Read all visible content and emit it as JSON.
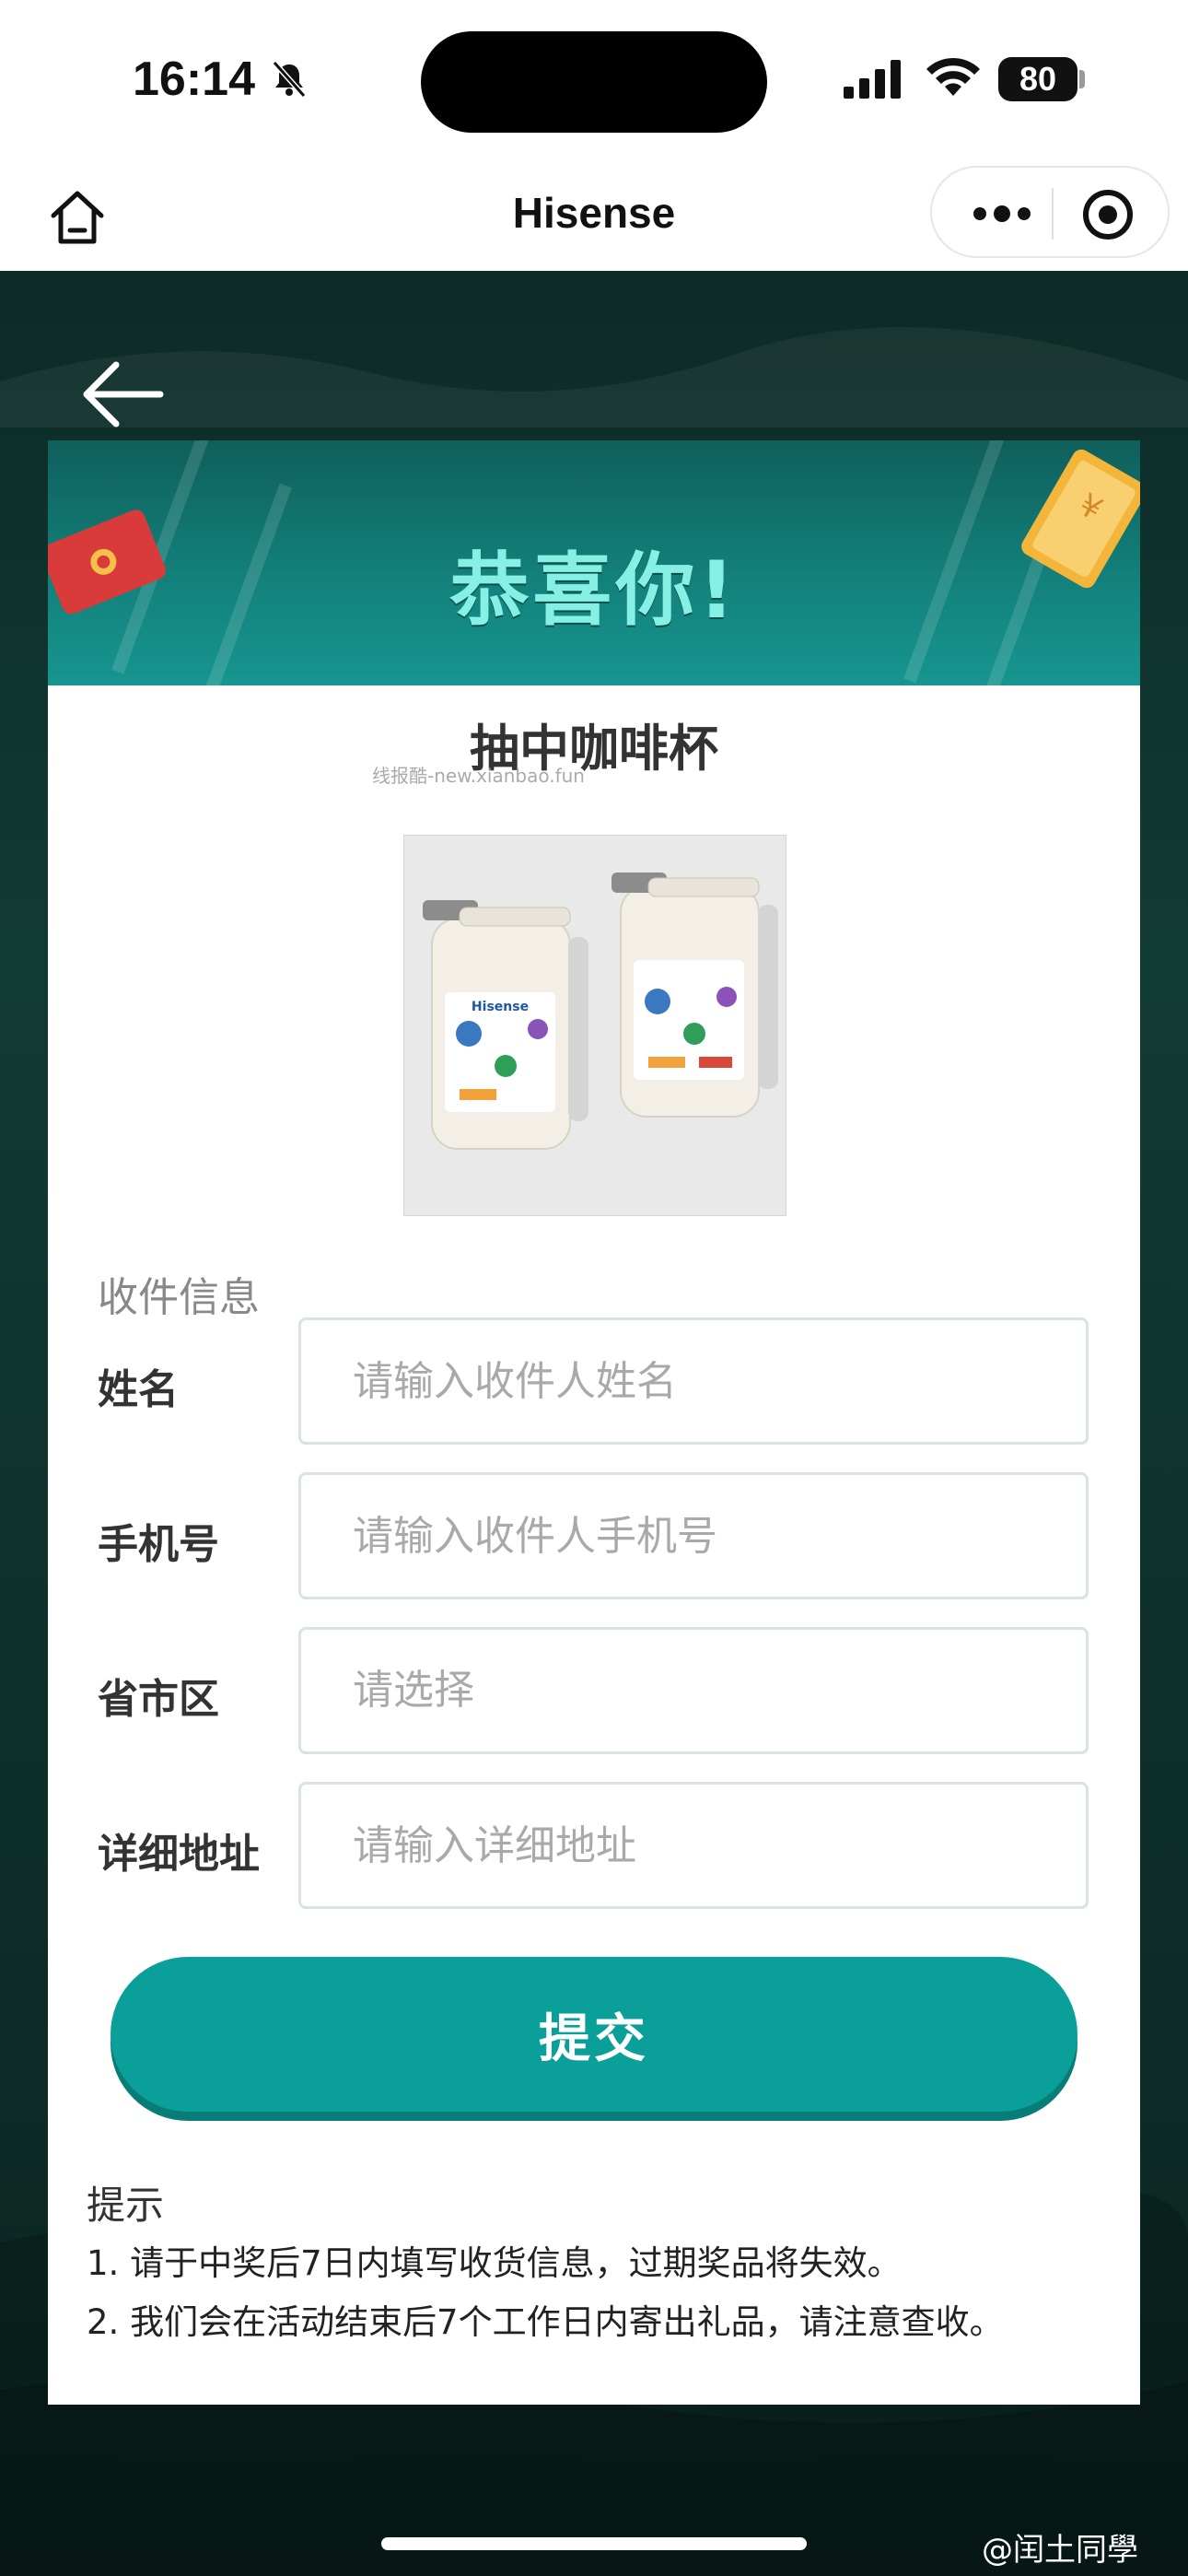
{
  "status_bar": {
    "time": "16:14",
    "battery": "80"
  },
  "nav": {
    "title": "Hisense"
  },
  "header": {
    "congrats": "恭喜你!"
  },
  "prize": {
    "title": "抽中咖啡杯",
    "watermark": "线报酷-new.xianbao.fun",
    "image_icon": "coffee-cup-image"
  },
  "form": {
    "section_label": "收件信息",
    "name": {
      "label": "姓名",
      "placeholder": "请输入收件人姓名"
    },
    "phone": {
      "label": "手机号",
      "placeholder": "请输入收件人手机号"
    },
    "region": {
      "label": "省市区",
      "placeholder": "请选择"
    },
    "address": {
      "label": "详细地址",
      "placeholder": "请输入详细地址"
    },
    "submit_label": "提交"
  },
  "tips": {
    "title": "提示",
    "items": [
      "1. 请于中奖后7日内填写收货信息，过期奖品将失效。",
      "2. 我们会在活动结束后7个工作日内寄出礼品，请注意查收。"
    ]
  },
  "footer": {
    "weibo_mark": "@闰土同學"
  },
  "colors": {
    "accent": "#0a9f98",
    "header_dark": "#0f5f5b",
    "congrats_text": "#86f0e4",
    "background": "#123a35"
  }
}
